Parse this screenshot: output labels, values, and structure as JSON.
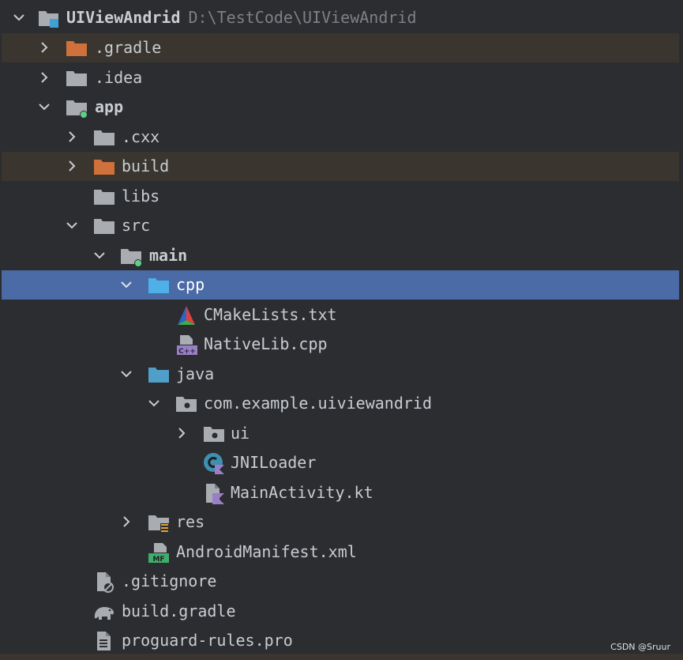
{
  "tree": {
    "root": {
      "label": "UIViewAndrid",
      "path": "D:\\TestCode\\UIViewAndrid"
    },
    "gradle": ".gradle",
    "idea": ".idea",
    "app": "app",
    "cxx": ".cxx",
    "build": "build",
    "libs": "libs",
    "src": "src",
    "main": "main",
    "cpp": "cpp",
    "cmakelists": "CMakeLists.txt",
    "nativelib": "NativeLib.cpp",
    "java": "java",
    "package": "com.example.uiviewandrid",
    "ui": "ui",
    "jniloader": "JNILoader",
    "mainactivity": "MainActivity.kt",
    "res": "res",
    "manifest": "AndroidManifest.xml",
    "gitignore": ".gitignore",
    "buildgradle": "build.gradle",
    "proguard": "proguard-rules.pro"
  },
  "icons": {
    "cpp_badge": "C++",
    "manifest_badge": "MF"
  },
  "watermark": "CSDN @Sruur",
  "colors": {
    "background": "#2b2d30",
    "selection": "#4a6ba6",
    "excluded_row": "#3a362f",
    "folder_gray": "#a9acb1",
    "folder_excluded": "#d0703a",
    "folder_source": "#4f9fc8",
    "module_dot": "#5fd088"
  }
}
